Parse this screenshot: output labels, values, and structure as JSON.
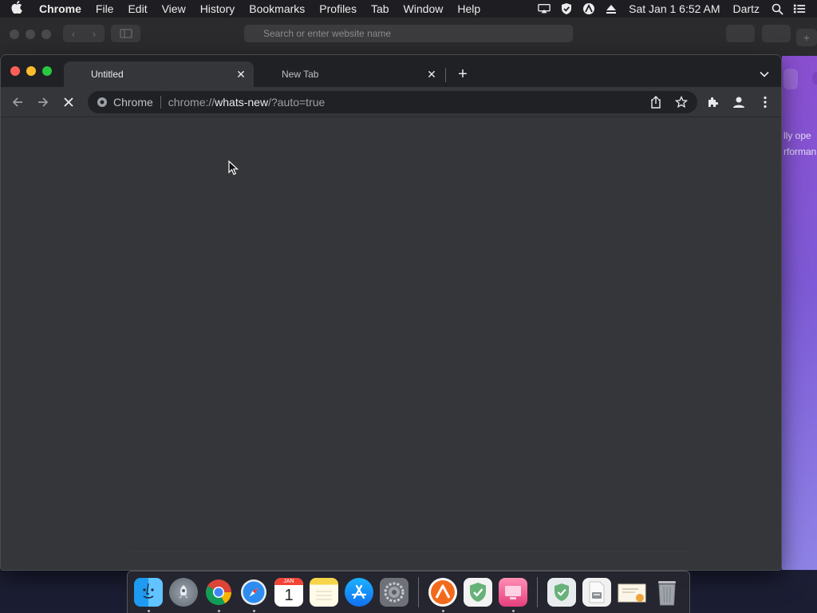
{
  "menubar": {
    "app_name": "Chrome",
    "menus": [
      "File",
      "Edit",
      "View",
      "History",
      "Bookmarks",
      "Profiles",
      "Tab",
      "Window",
      "Help"
    ],
    "clock": "Sat Jan 1  6:52 AM",
    "user": "Dartz"
  },
  "safari": {
    "address_placeholder": "Search or enter website name"
  },
  "background_page": {
    "line1": "lly ope",
    "line2": "rforman"
  },
  "chrome": {
    "tabs": [
      {
        "title": "Untitled",
        "active": true
      },
      {
        "title": "New Tab",
        "active": false
      }
    ],
    "omnibox": {
      "chip": "Chrome",
      "url_scheme": "chrome://",
      "url_host": "whats-new",
      "url_rest": "/?auto=true"
    }
  },
  "dock": {
    "apps": [
      "finder-icon",
      "launchpad-icon",
      "chrome-icon",
      "safari-icon",
      "calendar-icon",
      "notes-icon",
      "app-store-icon",
      "system-preferences-icon",
      "vpn-app-icon",
      "adguard-icon",
      "cleanmymac-icon",
      "adguard-installer-icon",
      "disk-image-icon",
      "certificate-icon",
      "trash-icon"
    ],
    "calendar_month": "JAN",
    "calendar_day": "1"
  },
  "colors": {
    "chrome_frame": "#202124",
    "chrome_toolbar": "#35363a",
    "omnibox": "#202124",
    "text": "#e8eaed"
  }
}
